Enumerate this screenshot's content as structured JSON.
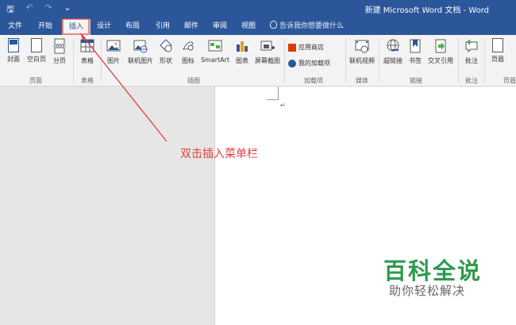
{
  "window": {
    "title": "新建 Microsoft Word 文档 - Word",
    "qat": {
      "save": "🖫",
      "undo": "↶",
      "redo": "↷",
      "more": "⌄"
    }
  },
  "tabs": [
    {
      "label": "文件"
    },
    {
      "label": "开始"
    },
    {
      "label": "插入"
    },
    {
      "label": "设计"
    },
    {
      "label": "布局"
    },
    {
      "label": "引用"
    },
    {
      "label": "邮件"
    },
    {
      "label": "审阅"
    },
    {
      "label": "视图"
    }
  ],
  "tellme": "告诉我你想要做什么",
  "ribbon": {
    "pages": {
      "cover": "封面",
      "blank": "空白页",
      "break": "分页",
      "group": "页面"
    },
    "tables": {
      "table": "表格",
      "group": "表格"
    },
    "illustrations": {
      "picture": "图片",
      "online_picture": "联机图片",
      "shapes": "形状",
      "icons": "图标",
      "smartart": "SmartArt",
      "chart": "图表",
      "screenshot": "屏幕截图",
      "group": "插图"
    },
    "addins": {
      "store": "应用商店",
      "my_addins": "我的加载项",
      "group": "加载项"
    },
    "media": {
      "online_video": "联机视频",
      "group": "媒体"
    },
    "links": {
      "hyperlink": "超链接",
      "bookmark": "书签",
      "crossref": "交叉引用",
      "group": "链接"
    },
    "comments": {
      "comment": "批注",
      "group": "批注"
    },
    "header": {
      "header": "页眉",
      "group": "页眉"
    }
  },
  "document": {
    "paragraph_mark": "↵"
  },
  "annotation": "双击插入菜单栏",
  "watermark": {
    "title": "百科全说",
    "subtitle": "助你轻松解决"
  },
  "colors": {
    "accent": "#2b579a",
    "annotation": "#e04040",
    "watermark": "#2e9a4e"
  }
}
